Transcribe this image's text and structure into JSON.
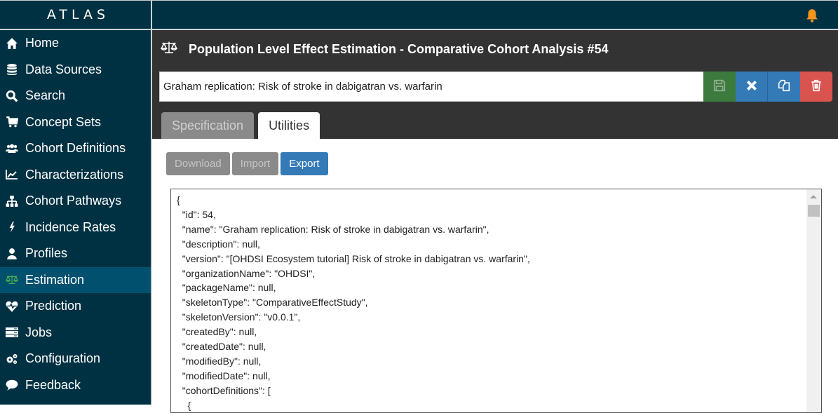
{
  "app": {
    "brand": "ATLAS"
  },
  "sidebar": {
    "items": [
      {
        "label": "Home",
        "icon": "home-icon"
      },
      {
        "label": "Data Sources",
        "icon": "database-icon"
      },
      {
        "label": "Search",
        "icon": "search-icon"
      },
      {
        "label": "Concept Sets",
        "icon": "shopping-cart-icon"
      },
      {
        "label": "Cohort Definitions",
        "icon": "users-icon"
      },
      {
        "label": "Characterizations",
        "icon": "line-chart-icon"
      },
      {
        "label": "Cohort Pathways",
        "icon": "sitemap-icon"
      },
      {
        "label": "Incidence Rates",
        "icon": "bolt-icon"
      },
      {
        "label": "Profiles",
        "icon": "user-icon"
      },
      {
        "label": "Estimation",
        "icon": "balance-scale-icon",
        "active": true
      },
      {
        "label": "Prediction",
        "icon": "heartbeat-icon"
      },
      {
        "label": "Jobs",
        "icon": "tasks-icon"
      },
      {
        "label": "Configuration",
        "icon": "cogs-icon"
      },
      {
        "label": "Feedback",
        "icon": "comment-icon"
      }
    ]
  },
  "topbar": {
    "notification_icon": "bell-icon",
    "accent": "#f7941d"
  },
  "header": {
    "title": "Population Level Effect Estimation - Comparative Cohort Analysis #54",
    "name_value": "Graham replication: Risk of stroke in dabigatran vs. warfarin",
    "buttons": {
      "save": "save-icon",
      "close": "close-icon",
      "copy": "copy-icon",
      "delete": "trash-icon"
    },
    "tabs": [
      {
        "label": "Specification",
        "active": false
      },
      {
        "label": "Utilities",
        "active": true
      }
    ]
  },
  "utilities": {
    "download_label": "Download",
    "import_label": "Import",
    "export_label": "Export",
    "json_text": "{\n  \"id\": 54,\n  \"name\": \"Graham replication: Risk of stroke in dabigatran vs. warfarin\",\n  \"description\": null,\n  \"version\": \"[OHDSI Ecosystem tutorial] Risk of stroke in dabigatran vs. warfarin\",\n  \"organizationName\": \"OHDSI\",\n  \"packageName\": null,\n  \"skeletonType\": \"ComparativeEffectStudy\",\n  \"skeletonVersion\": \"v0.0.1\",\n  \"createdBy\": null,\n  \"createdDate\": null,\n  \"modifiedBy\": null,\n  \"modifiedDate\": null,\n  \"cohortDefinitions\": [\n    {"
  },
  "colors": {
    "sidebar_bg": "#003142",
    "active_item_bg": "#00506e",
    "header_bg": "#333333",
    "save_green": "#3d7a3d",
    "primary_blue": "#337ab7",
    "danger_red": "#d9534f"
  }
}
